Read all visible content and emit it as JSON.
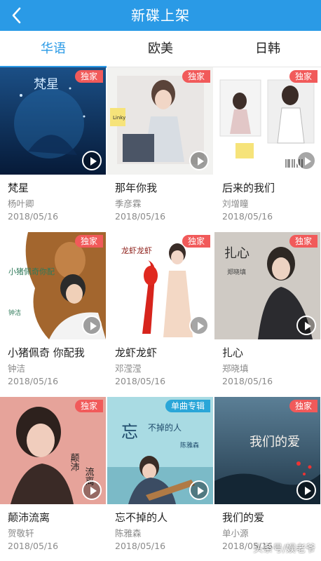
{
  "header": {
    "title": "新碟上架",
    "back_icon": "back-icon"
  },
  "tabs": [
    {
      "label": "华语",
      "active": true
    },
    {
      "label": "欧美",
      "active": false
    },
    {
      "label": "日韩",
      "active": false
    }
  ],
  "colors": {
    "accent": "#2a9ae6",
    "badge": "#f15a5a"
  },
  "albums": [
    {
      "name": "梵星",
      "artist": "杨叶卿",
      "date": "2018/05/16",
      "badge": "独家"
    },
    {
      "name": "那年你我",
      "artist": "季彦霖",
      "date": "2018/05/16",
      "badge": "独家"
    },
    {
      "name": "后来的我们",
      "artist": "刘增瞳",
      "date": "2018/05/16",
      "badge": "独家"
    },
    {
      "name": "小猪佩奇 你配我",
      "artist": "钟洁",
      "date": "2018/05/16",
      "badge": "独家"
    },
    {
      "name": "龙虾龙虾",
      "artist": "邓滢滢",
      "date": "2018/05/16",
      "badge": "独家"
    },
    {
      "name": "扎心",
      "artist": "郑晓填",
      "date": "2018/05/16",
      "badge": "独家"
    },
    {
      "name": "颠沛流离",
      "artist": "贺敬轩",
      "date": "2018/05/16",
      "badge": "独家"
    },
    {
      "name": "忘不掉的人",
      "artist": "陈雅森",
      "date": "2018/05/16",
      "badge": "单曲专辑"
    },
    {
      "name": "我们的爱",
      "artist": "单小源",
      "date": "2018/05/16",
      "badge": "独家"
    }
  ],
  "cover_text": {
    "album_0": "梵星",
    "album_1": "Linky",
    "album_3_a": "小猪佩奇你配",
    "album_3_b": "钟洁",
    "album_4": "龙虾龙虾",
    "album_5_a": "扎心",
    "album_5_b": "郑晓填",
    "album_6_a": "颠沛",
    "album_6_b": "流离",
    "album_7_a": "忘",
    "album_7_b": "不掉的人",
    "album_7_c": "陈雅森",
    "album_8": "我们的爱"
  },
  "watermark": "头条号/娱老爷"
}
